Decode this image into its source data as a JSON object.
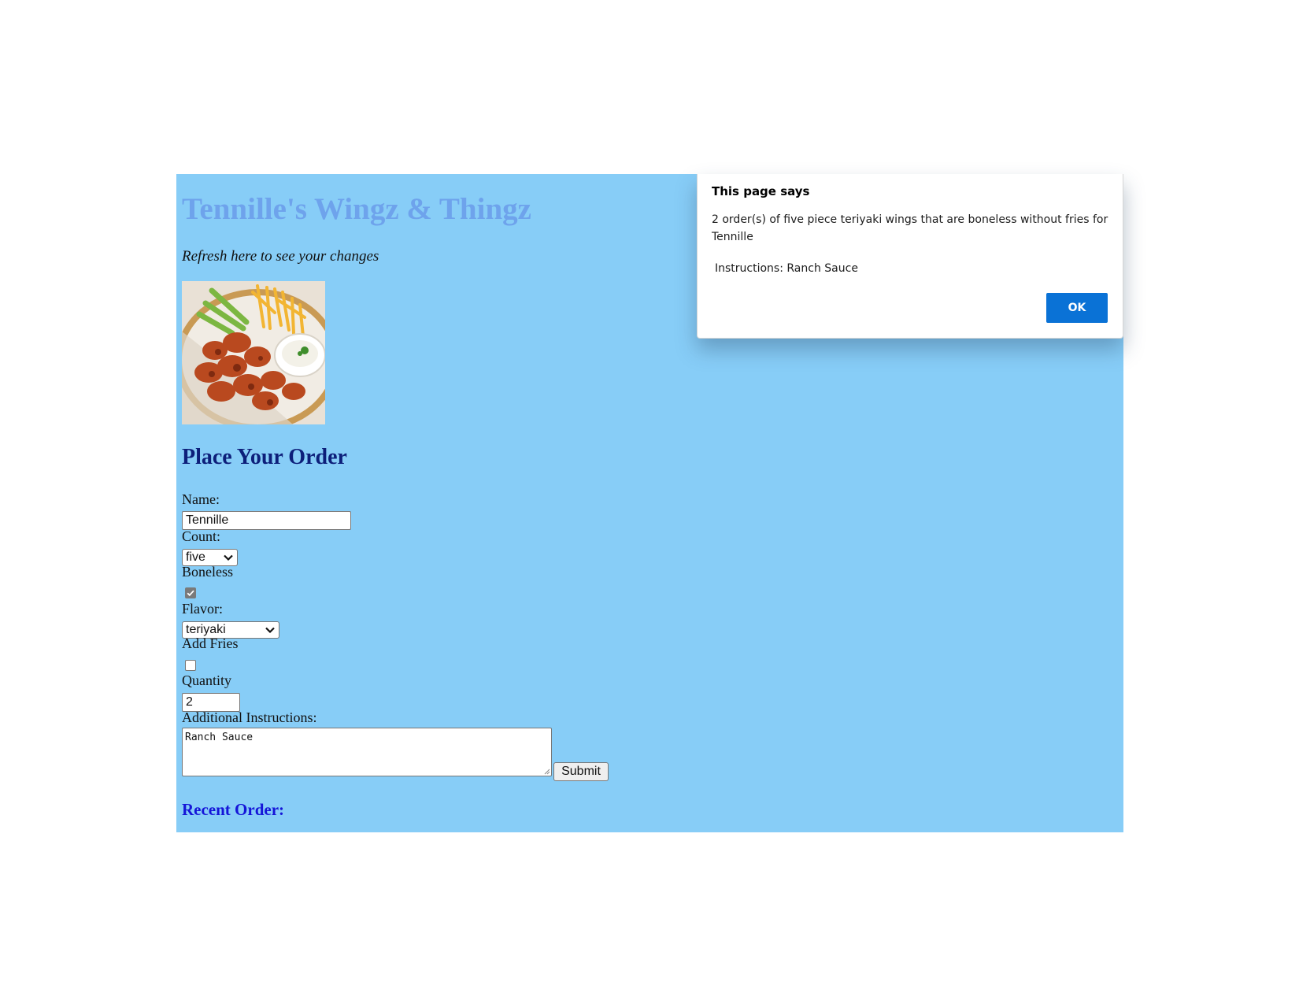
{
  "site": {
    "title": "Tennille's Wingz & Thingz",
    "refresh_text": "Refresh here to see your changes"
  },
  "form": {
    "heading": "Place Your Order",
    "name_label": "Name:",
    "name_value": "Tennille",
    "count_label": "Count:",
    "count_value": "five",
    "boneless_label": "Boneless",
    "boneless_checked": true,
    "flavor_label": "Flavor:",
    "flavor_value": "teriyaki",
    "fries_label": "Add Fries",
    "fries_checked": false,
    "quantity_label": "Quantity",
    "quantity_value": "2",
    "instructions_label": "Additional Instructions:",
    "instructions_value": "Ranch Sauce",
    "submit_label": "Submit"
  },
  "recent": {
    "heading": "Recent Order:"
  },
  "dialog": {
    "title": "This page says",
    "message": "2 order(s) of five piece teriyaki wings that are boneless without fries for Tennille",
    "instructions": "Instructions: Ranch Sauce",
    "ok_label": "OK"
  },
  "colors": {
    "page_background": "#87cdf7",
    "title_color": "#6ea3ec",
    "heading_color": "#0d1f7a",
    "recent_color": "#1515d8",
    "ok_button": "#0a72d6"
  },
  "icons": {
    "food_image": "wings-and-fries-photo",
    "select_arrow": "chevron-down-icon",
    "check": "checkmark-icon",
    "resize": "resize-grip-icon"
  }
}
